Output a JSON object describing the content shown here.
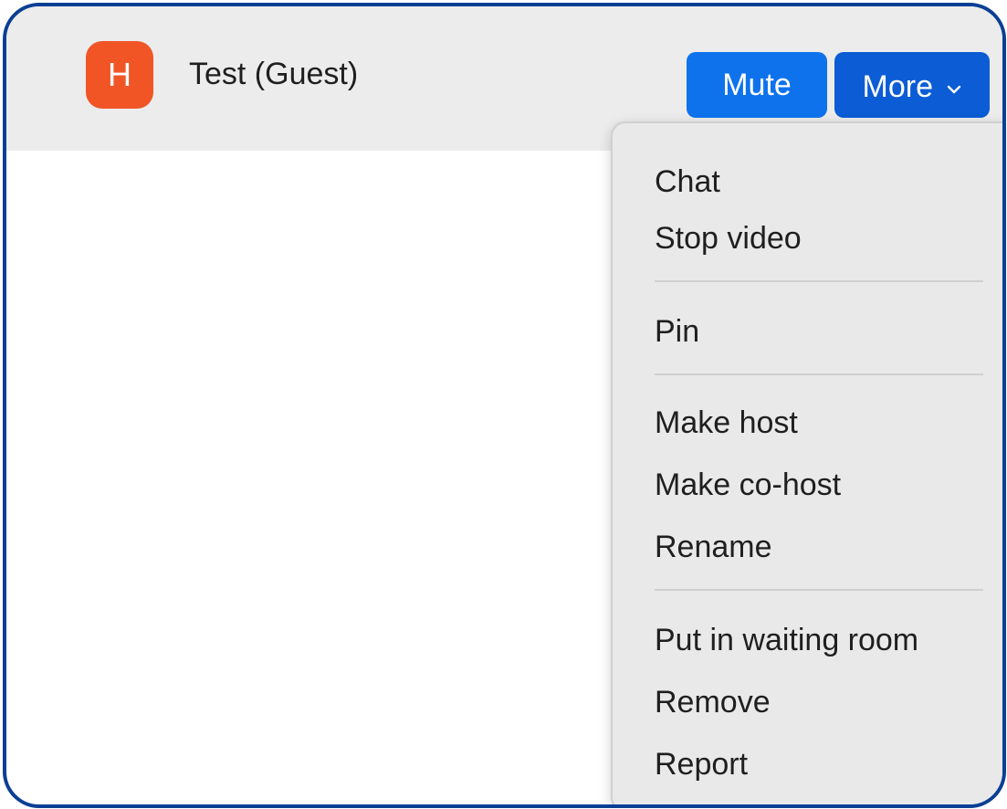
{
  "participant": {
    "avatar_initial": "H",
    "name": "Test (Guest)"
  },
  "buttons": {
    "mute": "Mute",
    "more": "More"
  },
  "menu": {
    "items": [
      "Chat",
      "Stop video",
      "Pin",
      "Make host",
      "Make co-host",
      "Rename",
      "Put in waiting room",
      "Remove",
      "Report"
    ]
  },
  "colors": {
    "frame_border": "#0b3f94",
    "header_bg": "#ececec",
    "avatar_bg": "#f15526",
    "mute_bg": "#0e72ed",
    "more_bg": "#0b5cd5",
    "menu_bg": "#e9e9e9"
  }
}
